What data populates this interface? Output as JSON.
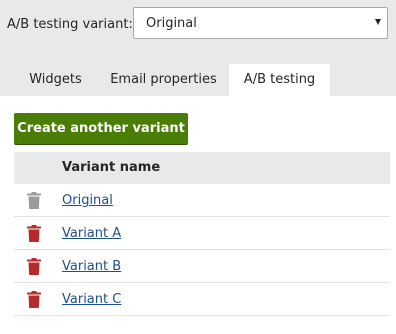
{
  "variant_selector": {
    "label": "A/B testing variant:",
    "selected": "Original"
  },
  "tabs": [
    {
      "label": "Widgets",
      "active": false
    },
    {
      "label": "Email properties",
      "active": false
    },
    {
      "label": "A/B testing",
      "active": true
    }
  ],
  "create_button": {
    "label": "Create another variant"
  },
  "variants_grid": {
    "column_header": "Variant name",
    "rows": [
      {
        "name": "Original",
        "delete_enabled": false,
        "delete_icon_color": "#9c9c9c"
      },
      {
        "name": "Variant A",
        "delete_enabled": true,
        "delete_icon_color": "#b7292a"
      },
      {
        "name": "Variant B",
        "delete_enabled": true,
        "delete_icon_color": "#b7292a"
      },
      {
        "name": "Variant C",
        "delete_enabled": true,
        "delete_icon_color": "#b7292a"
      }
    ]
  },
  "colors": {
    "primary_button": "#497d04",
    "link": "#1f4e8c",
    "toolbar_background": "#e9e9e9"
  }
}
